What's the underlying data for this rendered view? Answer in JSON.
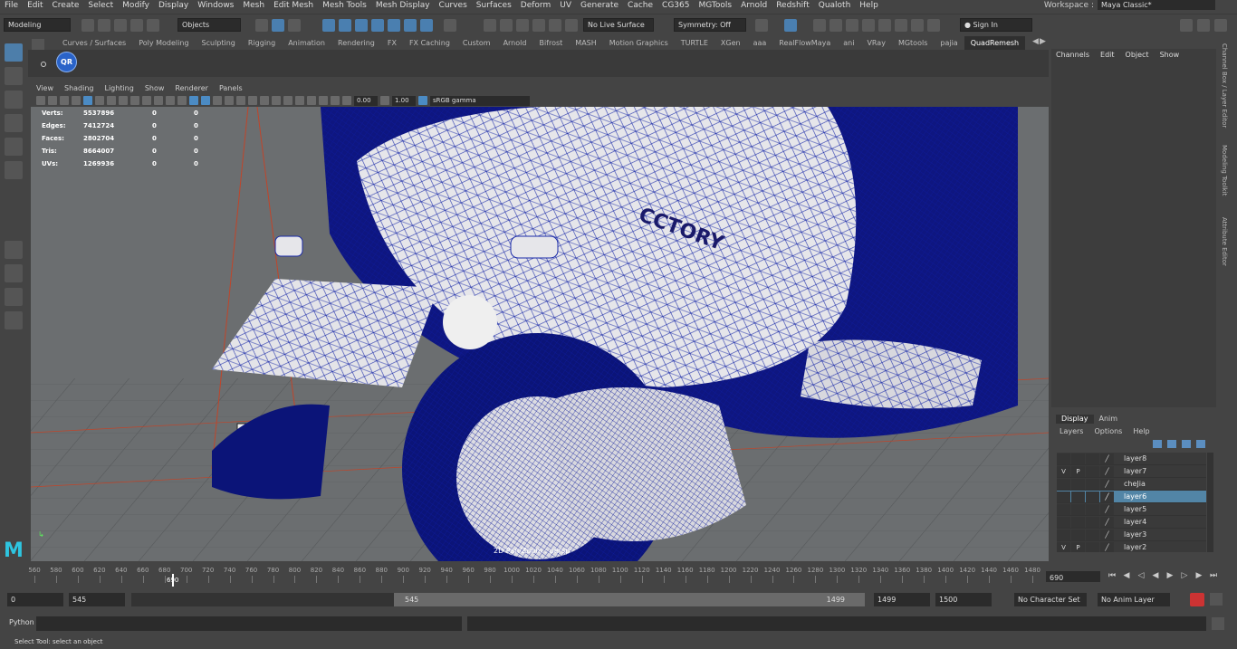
{
  "menubar": {
    "items": [
      "File",
      "Edit",
      "Create",
      "Select",
      "Modify",
      "Display",
      "Windows",
      "Mesh",
      "Edit Mesh",
      "Mesh Tools",
      "Mesh Display",
      "Curves",
      "Surfaces",
      "Deform",
      "UV",
      "Generate",
      "Cache",
      "CG365",
      "MGTools",
      "Arnold",
      "Redshift",
      "Qualoth",
      "Help"
    ],
    "workspace_label": "Workspace :",
    "workspace_value": "Maya Classic*"
  },
  "statusline": {
    "mode": "Modeling",
    "selection_mode": "Objects",
    "live_surface": "No Live Surface",
    "symmetry": "Symmetry: Off",
    "sign_in": "Sign In"
  },
  "shelf": {
    "tabs": [
      "Curves / Surfaces",
      "Poly Modeling",
      "Sculpting",
      "Rigging",
      "Animation",
      "Rendering",
      "FX",
      "FX Caching",
      "Custom",
      "Arnold",
      "Bifrost",
      "MASH",
      "Motion Graphics",
      "TURTLE",
      "XGen",
      "aaa",
      "RealFlowMaya",
      "ani",
      "VRay",
      "MGtools",
      "pajia",
      "QuadRemesh"
    ],
    "active_tab": "QuadRemesh",
    "qr_button": "QR"
  },
  "viewport": {
    "menu": [
      "View",
      "Shading",
      "Lighting",
      "Show",
      "Renderer",
      "Panels"
    ],
    "exposure": "0.00",
    "gamma": "1.00",
    "color_space": "sRGB gamma",
    "camera_label": "2D Pan/Zoom : persp",
    "logo_text": "CCTORY",
    "hud": [
      {
        "label": "Verts:",
        "value": "5537896",
        "a": "0",
        "b": "0"
      },
      {
        "label": "Edges:",
        "value": "7412724",
        "a": "0",
        "b": "0"
      },
      {
        "label": "Faces:",
        "value": "2802704",
        "a": "0",
        "b": "0"
      },
      {
        "label": "Tris:",
        "value": "8664007",
        "a": "0",
        "b": "0"
      },
      {
        "label": "UVs:",
        "value": "1269936",
        "a": "0",
        "b": "0"
      }
    ]
  },
  "channelbox": {
    "menu": [
      "Channels",
      "Edit",
      "Object",
      "Show"
    ],
    "side_tabs": [
      "Channel Box / Layer Editor",
      "Modeling Toolkit",
      "Attribute Editor"
    ]
  },
  "layers": {
    "tabs": [
      "Display",
      "Anim"
    ],
    "menu": [
      "Layers",
      "Options",
      "Help"
    ],
    "rows": [
      {
        "v": "",
        "p": "",
        "name": "layer8"
      },
      {
        "v": "V",
        "p": "P",
        "name": "layer7"
      },
      {
        "v": "",
        "p": "",
        "name": "cheJia"
      },
      {
        "v": "",
        "p": "",
        "name": "layer6"
      },
      {
        "v": "",
        "p": "",
        "name": "layer5"
      },
      {
        "v": "",
        "p": "",
        "name": "layer4"
      },
      {
        "v": "",
        "p": "",
        "name": "layer3"
      },
      {
        "v": "V",
        "p": "P",
        "name": "layer2"
      }
    ],
    "selected": "layer6"
  },
  "timeslider": {
    "ticks": [
      "560",
      "580",
      "600",
      "620",
      "640",
      "660",
      "680",
      "700",
      "720",
      "740",
      "760",
      "780",
      "800",
      "820",
      "840",
      "860",
      "880",
      "900",
      "920",
      "940",
      "960",
      "980",
      "1000",
      "1020",
      "1040",
      "1060",
      "1080",
      "1100",
      "1120",
      "1140",
      "1160",
      "1180",
      "1200",
      "1220",
      "1240",
      "1260",
      "1280",
      "1300",
      "1320",
      "1340",
      "1360",
      "1380",
      "1400",
      "1420",
      "1440",
      "1460",
      "1480"
    ],
    "current_frame": "690",
    "current_frame_field": "690"
  },
  "range": {
    "start": "0",
    "inner_start": "545",
    "handle_start": "545",
    "handle_end": "1499",
    "inner_end": "1499",
    "end": "1500",
    "character_set": "No Character Set",
    "anim_layer": "No Anim Layer"
  },
  "cmdline": {
    "label": "Python"
  },
  "helpline": {
    "text": "Select Tool: select an object"
  }
}
